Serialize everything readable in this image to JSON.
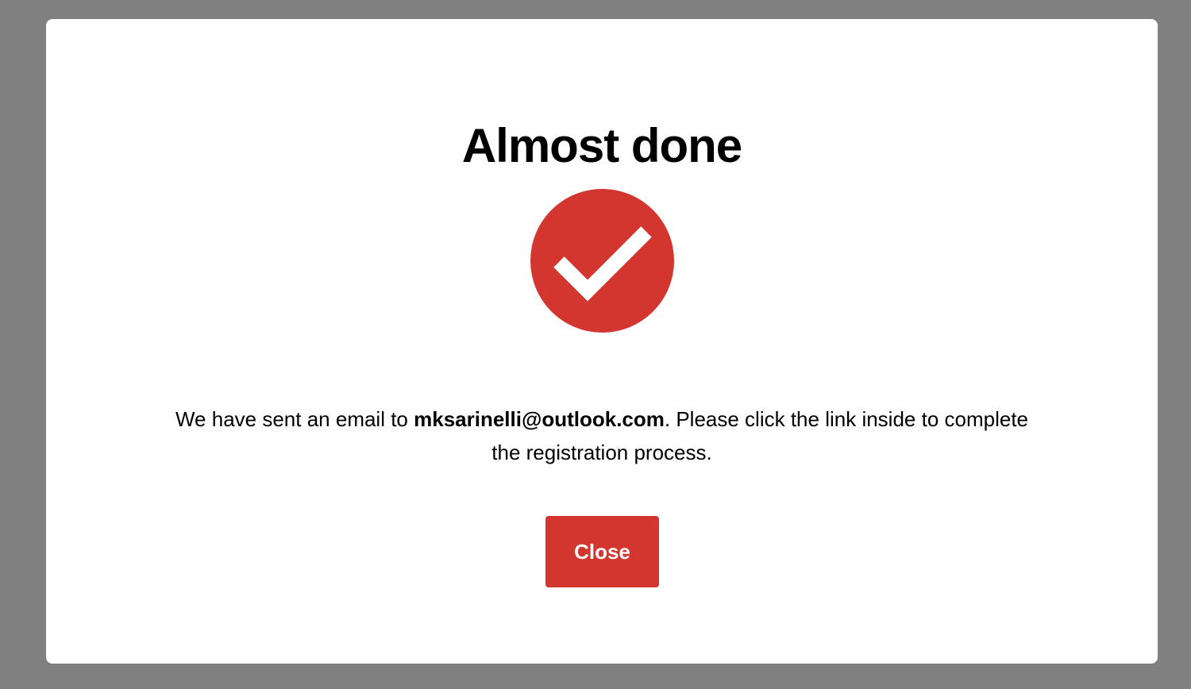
{
  "modal": {
    "title": "Almost done",
    "status_icon": "check-circle-icon",
    "message": {
      "before": "We have sent an email to ",
      "email": "mksarinelli@outlook.com",
      "after": ". Please click the link inside to complete the registration process."
    },
    "close_label": "Close"
  },
  "colors": {
    "accent": "#d2362e",
    "overlay": "#808080",
    "surface": "#ffffff"
  }
}
